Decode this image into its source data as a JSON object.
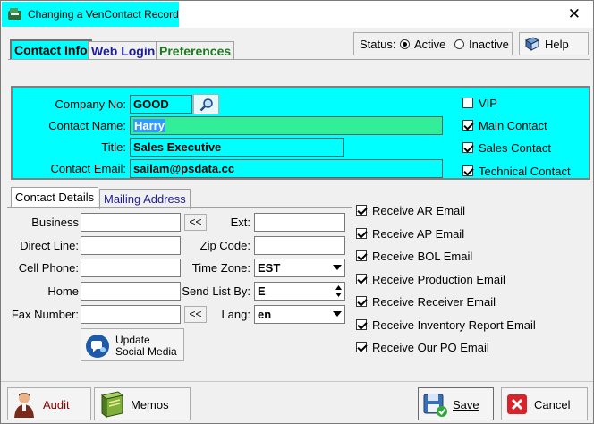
{
  "window": {
    "title": "Changing a VenContact Record",
    "close_symbol": "✕"
  },
  "tabs": [
    {
      "label": "Contact Info",
      "active": true
    },
    {
      "label": "Web Login",
      "active": false
    },
    {
      "label": "Preferences",
      "active": false
    }
  ],
  "status": {
    "label": "Status:",
    "active_label": "Active",
    "inactive_label": "Inactive",
    "selected": "Active"
  },
  "help_label": "Help",
  "header": {
    "company_no_label": "Company No:",
    "company_no": "GOOD",
    "contact_name_label": "Contact Name:",
    "contact_name": "Harry",
    "title_label": "Title:",
    "title": "Sales Executive",
    "email_label": "Contact Email:",
    "email": "sailam@psdata.cc"
  },
  "flags": [
    {
      "label": "VIP",
      "checked": false
    },
    {
      "label": "Main Contact",
      "checked": true
    },
    {
      "label": "Sales Contact",
      "checked": true
    },
    {
      "label": "Technical Contact",
      "checked": true
    }
  ],
  "subtabs": [
    {
      "label": "Contact Details",
      "active": true
    },
    {
      "label": "Mailing Address",
      "active": false
    }
  ],
  "details": {
    "business_label": "Business",
    "business": "",
    "direct_line_label": "Direct Line:",
    "direct_line": "",
    "cell_phone_label": "Cell Phone:",
    "cell_phone": "",
    "home_label": "Home",
    "home": "",
    "fax_label": "Fax Number:",
    "fax": "",
    "ext_label": "Ext:",
    "ext": "",
    "zip_label": "Zip Code:",
    "zip": "",
    "timezone_label": "Time Zone:",
    "timezone": "EST",
    "sendlist_label": "Send List By:",
    "sendlist": "E",
    "lang_label": "Lang:",
    "lang": "en",
    "copy_symbol": "<<",
    "update_social_line1": "Update",
    "update_social_line2": "Social Media"
  },
  "emails": [
    {
      "label": "Receive AR Email",
      "checked": true
    },
    {
      "label": "Receive AP Email",
      "checked": true
    },
    {
      "label": "Receive BOL Email",
      "checked": true
    },
    {
      "label": "Receive Production Email",
      "checked": true
    },
    {
      "label": "Receive Receiver Email",
      "checked": true
    },
    {
      "label": "Receive Inventory Report Email",
      "checked": true
    },
    {
      "label": "Receive Our PO Email",
      "checked": true
    }
  ],
  "footer": {
    "audit": "Audit",
    "memos": "Memos",
    "save": "Save",
    "cancel": "Cancel"
  },
  "colors": {
    "accent": "#00ffff",
    "highlight": "#33ee99",
    "selection": "#3399ff",
    "audit_text": "#8b0000"
  }
}
